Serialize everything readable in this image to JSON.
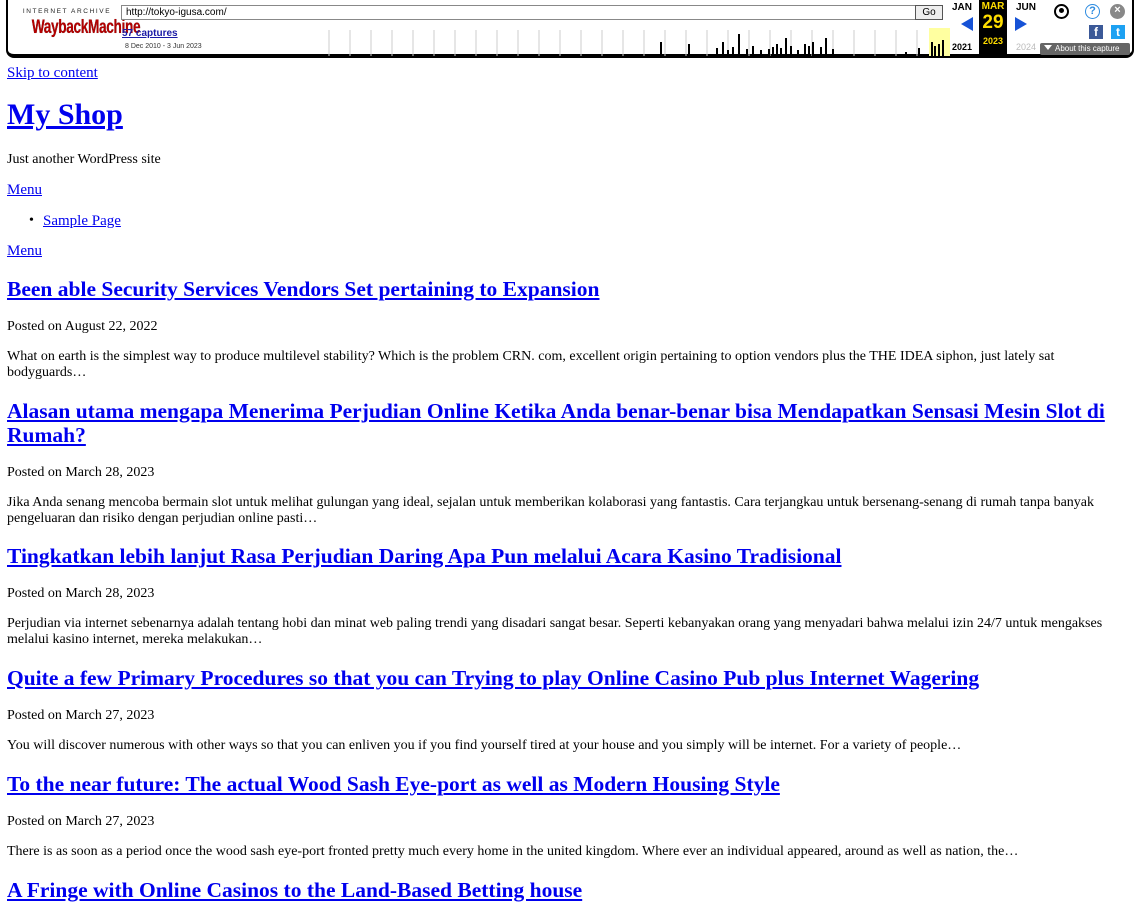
{
  "wayback": {
    "logo_top": "INTERNET ARCHIVE",
    "logo_main": "WaybackMachine",
    "url": "http://tokyo-igusa.com/",
    "go_label": "Go",
    "captures": "57 captures",
    "date_range": "8 Dec 2010 - 3 Jun 2023",
    "month_prev": "JAN",
    "month_cur": "MAR",
    "month_next": "JUN",
    "day_cur": "29",
    "year_prev": "2021",
    "year_cur": "2023",
    "year_next": "2024",
    "about_label": "About this capture",
    "icons": [
      "user-icon",
      "help-icon",
      "close-icon",
      "facebook-icon",
      "twitter-icon"
    ],
    "accent": "#1652d6",
    "highlight": "#ffdd00"
  },
  "page": {
    "skip_link": "Skip to content",
    "site_title": "My Shop",
    "tagline": "Just another WordPress site",
    "menu_toggle": "Menu",
    "menu_items": [
      "Sample Page"
    ],
    "menu_toggle_2": "Menu",
    "link_color": "#0000ee"
  },
  "posts": [
    {
      "title": "Been able Security Services Vendors Set pertaining to Expansion",
      "meta_prefix": "Posted on",
      "date": "August 22, 2022",
      "excerpt": "What on earth is the simplest way to produce multilevel stability? Which is the problem CRN. com, excellent origin pertaining to option vendors plus the THE IDEA siphon, just lately sat bodyguards…"
    },
    {
      "title": "Alasan utama mengapa Menerima Perjudian Online Ketika Anda benar-benar bisa Mendapatkan Sensasi Mesin Slot di Rumah?",
      "meta_prefix": "Posted on",
      "date": "March 28, 2023",
      "excerpt": "Jika Anda senang mencoba bermain slot untuk melihat gulungan yang ideal, sejalan untuk memberikan kolaborasi yang fantastis. Cara terjangkau untuk bersenang-senang di rumah tanpa banyak pengeluaran dan risiko dengan perjudian online pasti…"
    },
    {
      "title": "Tingkatkan lebih lanjut Rasa Perjudian Daring Apa Pun melalui Acara Kasino Tradisional",
      "meta_prefix": "Posted on",
      "date": "March 28, 2023",
      "excerpt": "Perjudian via internet sebenarnya adalah tentang hobi dan minat web paling trendi yang disadari sangat besar. Seperti kebanyakan orang yang menyadari bahwa melalui izin 24/7 untuk mengakses melalui kasino internet, mereka melakukan…"
    },
    {
      "title": "Quite a few Primary Procedures so that you can Trying to play Online Casino Pub plus Internet Wagering",
      "meta_prefix": "Posted on",
      "date": "March 27, 2023",
      "excerpt": "You will discover numerous with other ways so that you can enliven you if you find yourself tired at your house and you simply will be internet. For a variety of people…"
    },
    {
      "title": "To the near future: The actual Wood Sash Eye-port as well as Modern Housing Style",
      "meta_prefix": "Posted on",
      "date": "March 27, 2023",
      "excerpt": "There is as soon as a period once the wood sash eye-port fronted pretty much every home in the united kingdom. Where ever an individual appeared, around as well as nation, the…"
    },
    {
      "title": "A Fringe with Online Casinos to the Land-Based Betting house"
    }
  ]
}
